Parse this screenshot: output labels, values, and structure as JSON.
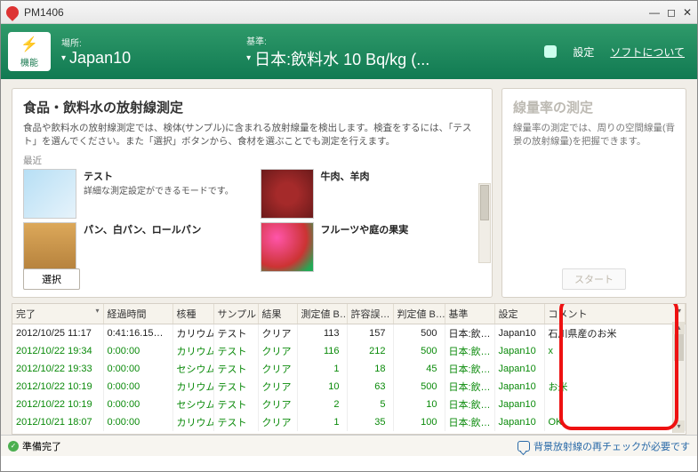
{
  "window": {
    "title": "PM1406"
  },
  "header": {
    "func_label": "機能",
    "place_label": "場所:",
    "place_value": "Japan10",
    "std_label": "基準:",
    "std_value": "日本:飲料水 10 Bq/kg (...",
    "settings": "設定",
    "about": "ソフトについて"
  },
  "left_panel": {
    "title": "食品・飲料水の放射線測定",
    "desc": "食品や飲料水の放射線測定では、検体(サンプル)に含まれる放射線量を検出します。検査をするには、「テスト」を選んでください。また「選択」ボタンから、食材を選ぶことでも測定を行えます。",
    "recent": "最近",
    "items": [
      {
        "title": "テスト",
        "desc": "詳細な測定設定ができるモードです。"
      },
      {
        "title": "牛肉、羊肉",
        "desc": ""
      },
      {
        "title": "パン、白パン、ロールパン",
        "desc": ""
      },
      {
        "title": "フルーツや庭の果実",
        "desc": ""
      }
    ],
    "select_btn": "選択"
  },
  "right_panel": {
    "title": "線量率の測定",
    "desc": "線量率の測定では、周りの空間線量(背景の放射線量)を把握できます。",
    "start_btn": "スタート"
  },
  "table": {
    "cols": [
      "完了",
      "経過時間",
      "核種",
      "サンプル",
      "結果",
      "測定値 B…",
      "許容誤…",
      "判定値 B…",
      "基準",
      "設定",
      "コメント"
    ],
    "rows": [
      {
        "done": true,
        "c": [
          "2012/10/25 11:17",
          "0:41:16.15…",
          "カリウム",
          "テスト",
          "クリア",
          "113",
          "157",
          "500",
          "日本:飲…",
          "Japan10",
          "石川県産のお米"
        ]
      },
      {
        "done": false,
        "c": [
          "2012/10/22 19:34",
          "0:00:00",
          "カリウム",
          "テスト",
          "クリア",
          "116",
          "212",
          "500",
          "日本:飲…",
          "Japan10",
          "x"
        ]
      },
      {
        "done": false,
        "c": [
          "2012/10/22 19:33",
          "0:00:00",
          "セシウム",
          "テスト",
          "クリア",
          "1",
          "18",
          "45",
          "日本:飲…",
          "Japan10",
          ""
        ]
      },
      {
        "done": false,
        "c": [
          "2012/10/22 10:19",
          "0:00:00",
          "カリウム",
          "テスト",
          "クリア",
          "10",
          "63",
          "500",
          "日本:飲…",
          "Japan10",
          "お米"
        ]
      },
      {
        "done": false,
        "c": [
          "2012/10/22 10:19",
          "0:00:00",
          "セシウム",
          "テスト",
          "クリア",
          "2",
          "5",
          "10",
          "日本:飲…",
          "Japan10",
          ""
        ]
      },
      {
        "done": false,
        "c": [
          "2012/10/21 18:07",
          "0:00:00",
          "カリウム",
          "テスト",
          "クリア",
          "1",
          "35",
          "100",
          "日本:飲…",
          "Japan10",
          "OK"
        ]
      }
    ]
  },
  "status": {
    "ready": "準備完了",
    "msg": "背景放射線の再チェックが必要です"
  }
}
